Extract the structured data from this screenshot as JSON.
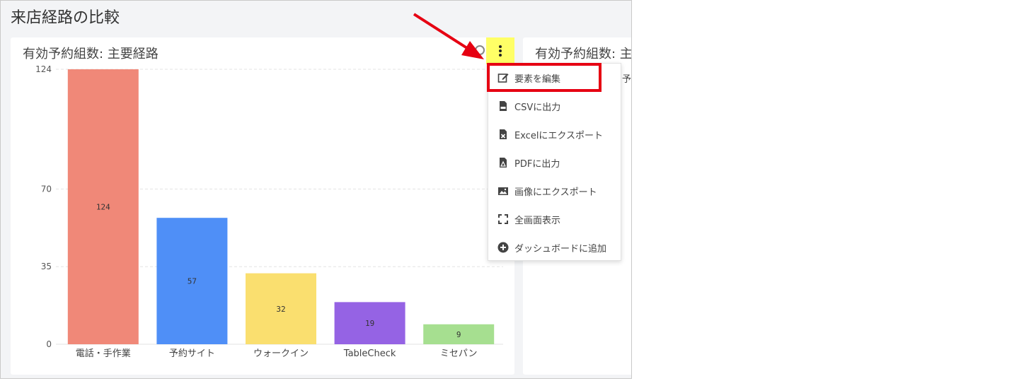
{
  "page": {
    "title": "来店経路の比較"
  },
  "cards": {
    "main_title": "有効予約組数: 主要経路",
    "second_title": "有効予約組数: 主",
    "second_peek": "予"
  },
  "menu": {
    "items": [
      {
        "label": "要素を編集",
        "icon": "edit-icon"
      },
      {
        "label": "CSVに出力",
        "icon": "csv-file-icon"
      },
      {
        "label": "Excelにエクスポート",
        "icon": "excel-file-icon"
      },
      {
        "label": "PDFに出力",
        "icon": "pdf-file-icon"
      },
      {
        "label": "画像にエクスポート",
        "icon": "image-icon"
      },
      {
        "label": "全画面表示",
        "icon": "fullscreen-icon"
      },
      {
        "label": "ダッシュボードに追加",
        "icon": "add-circle-icon"
      }
    ]
  },
  "colors": {
    "highlight": "#e60012",
    "kebab_bg": "#ffff66",
    "bars": [
      "#f08878",
      "#4f8ff7",
      "#fadf6f",
      "#9563e4",
      "#a6df90"
    ]
  },
  "chart_data": {
    "type": "bar",
    "categories": [
      "電話・手作業",
      "予約サイト",
      "ウォークイン",
      "TableCheck",
      "ミセパン"
    ],
    "values": [
      124,
      57,
      32,
      19,
      9
    ],
    "yticks": [
      "0",
      "35",
      "70",
      "124"
    ],
    "grid": true,
    "legend": "none"
  }
}
